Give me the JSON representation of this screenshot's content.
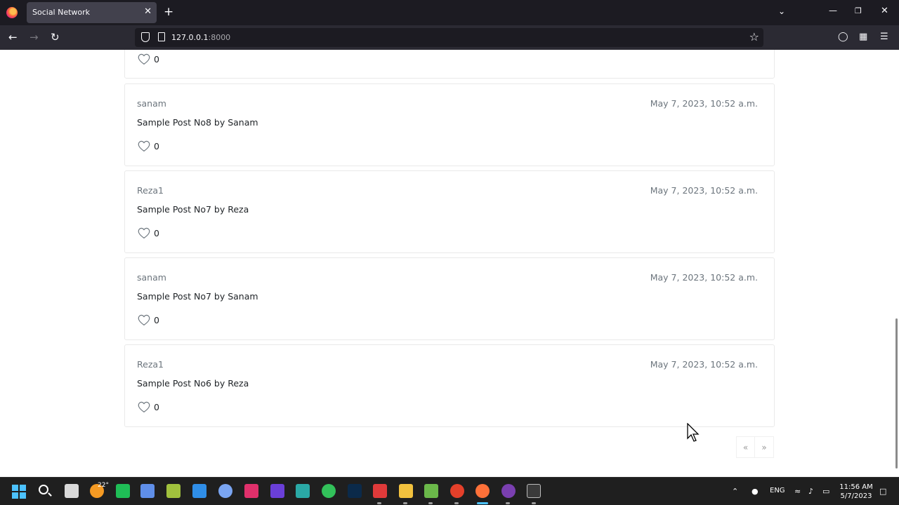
{
  "browser": {
    "tab_title": "Social Network",
    "tab_close": "✕",
    "new_tab": "+",
    "url_host": "127.0.0.1",
    "url_port": ":8000"
  },
  "posts": [
    {
      "author": "",
      "date": "",
      "content": "",
      "likes": "0"
    },
    {
      "author": "sanam",
      "date": "May 7, 2023, 10:52 a.m.",
      "content": "Sample Post No8 by Sanam",
      "likes": "0"
    },
    {
      "author": "Reza1",
      "date": "May 7, 2023, 10:52 a.m.",
      "content": "Sample Post No7 by Reza",
      "likes": "0"
    },
    {
      "author": "sanam",
      "date": "May 7, 2023, 10:52 a.m.",
      "content": "Sample Post No7 by Sanam",
      "likes": "0"
    },
    {
      "author": "Reza1",
      "date": "May 7, 2023, 10:52 a.m.",
      "content": "Sample Post No6 by Reza",
      "likes": "0"
    }
  ],
  "pagination": {
    "prev": "«",
    "next": "»"
  },
  "taskbar": {
    "weather_temp": "22°",
    "language": "ENG",
    "time": "11:56 AM",
    "date": "5/7/2023"
  },
  "colors": {
    "tab_strip": "#1c1b22",
    "toolbar": "#2b2a33",
    "accent": "#4cc2ff",
    "muted_text": "#6c757d"
  }
}
